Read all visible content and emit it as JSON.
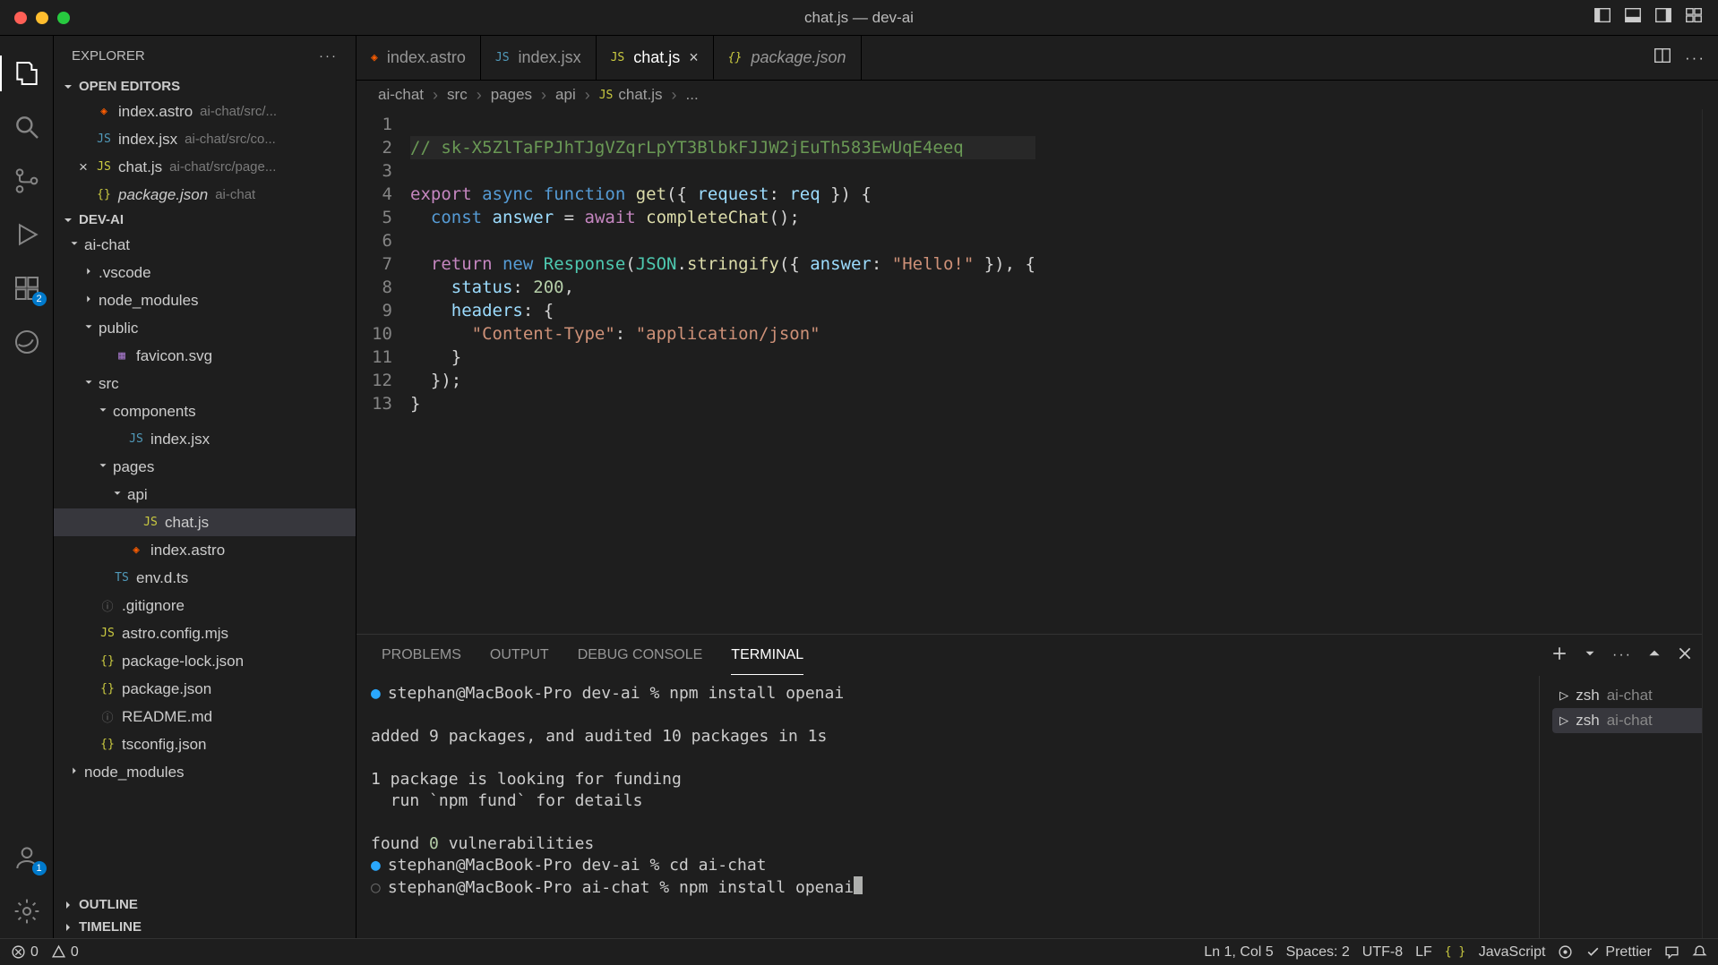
{
  "window": {
    "title": "chat.js — dev-ai"
  },
  "explorer": {
    "title": "EXPLORER",
    "openEditors": {
      "label": "OPEN EDITORS",
      "items": [
        {
          "name": "index.astro",
          "path": "ai-chat/src/...",
          "icon": "astro"
        },
        {
          "name": "index.jsx",
          "path": "ai-chat/src/co...",
          "icon": "jsx"
        },
        {
          "name": "chat.js",
          "path": "ai-chat/src/page...",
          "icon": "js",
          "closable": true
        },
        {
          "name": "package.json",
          "path": "ai-chat",
          "icon": "json",
          "italic": true
        }
      ]
    },
    "workspace": {
      "label": "DEV-AI",
      "tree": [
        {
          "name": "ai-chat",
          "type": "folder",
          "depth": 0,
          "expanded": true
        },
        {
          "name": ".vscode",
          "type": "folder",
          "depth": 1,
          "expanded": false
        },
        {
          "name": "node_modules",
          "type": "folder",
          "depth": 1,
          "expanded": false
        },
        {
          "name": "public",
          "type": "folder",
          "depth": 1,
          "expanded": true
        },
        {
          "name": "favicon.svg",
          "type": "file",
          "depth": 2,
          "icon": "svg"
        },
        {
          "name": "src",
          "type": "folder",
          "depth": 1,
          "expanded": true
        },
        {
          "name": "components",
          "type": "folder",
          "depth": 2,
          "expanded": true
        },
        {
          "name": "index.jsx",
          "type": "file",
          "depth": 3,
          "icon": "jsx"
        },
        {
          "name": "pages",
          "type": "folder",
          "depth": 2,
          "expanded": true
        },
        {
          "name": "api",
          "type": "folder",
          "depth": 3,
          "expanded": true
        },
        {
          "name": "chat.js",
          "type": "file",
          "depth": 4,
          "icon": "js",
          "active": true
        },
        {
          "name": "index.astro",
          "type": "file",
          "depth": 3,
          "icon": "astro"
        },
        {
          "name": "env.d.ts",
          "type": "file",
          "depth": 2,
          "icon": "ts"
        },
        {
          "name": ".gitignore",
          "type": "file",
          "depth": 1,
          "icon": "info"
        },
        {
          "name": "astro.config.mjs",
          "type": "file",
          "depth": 1,
          "icon": "js"
        },
        {
          "name": "package-lock.json",
          "type": "file",
          "depth": 1,
          "icon": "json"
        },
        {
          "name": "package.json",
          "type": "file",
          "depth": 1,
          "icon": "json"
        },
        {
          "name": "README.md",
          "type": "file",
          "depth": 1,
          "icon": "info"
        },
        {
          "name": "tsconfig.json",
          "type": "file",
          "depth": 1,
          "icon": "json"
        },
        {
          "name": "node_modules",
          "type": "folder",
          "depth": 0,
          "expanded": false
        }
      ]
    },
    "outline": "OUTLINE",
    "timeline": "TIMELINE"
  },
  "tabs": [
    {
      "name": "index.astro",
      "icon": "astro"
    },
    {
      "name": "index.jsx",
      "icon": "jsx"
    },
    {
      "name": "chat.js",
      "icon": "js",
      "active": true,
      "close": true
    },
    {
      "name": "package.json",
      "icon": "json",
      "italic": true
    }
  ],
  "breadcrumb": [
    "ai-chat",
    "src",
    "pages",
    "api",
    "chat.js",
    "..."
  ],
  "code": {
    "lines": 13,
    "l1_comment": "// 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",
    "l3": {
      "export": "export",
      "async": "async",
      "function": "function",
      "get": "get",
      "request": "request",
      "req": "req"
    },
    "l4": {
      "const": "const",
      "answer": "answer",
      "await": "await",
      "completeChat": "completeChat"
    },
    "l6": {
      "return": "return",
      "new": "new",
      "Response": "Response",
      "JSON": "JSON",
      "stringify": "stringify",
      "answer": "answer",
      "hello": "\"Hello!\""
    },
    "l7": {
      "status": "status",
      "v": "200"
    },
    "l8": {
      "headers": "headers"
    },
    "l9": {
      "key": "\"Content-Type\"",
      "val": "\"application/json\""
    }
  },
  "panel": {
    "tabs": {
      "problems": "PROBLEMS",
      "output": "OUTPUT",
      "debug": "DEBUG CONSOLE",
      "terminal": "TERMINAL"
    },
    "terminal": {
      "l1": {
        "prompt": "stephan@MacBook-Pro dev-ai %",
        "cmd": "npm install openai"
      },
      "l3": "added 9 packages, and audited 10 packages in 1s",
      "l5": "1 package is looking for funding",
      "l6": "  run `npm fund` for details",
      "l8a": "found ",
      "l8b": "0",
      "l8c": " vulnerabilities",
      "l9": {
        "prompt": "stephan@MacBook-Pro dev-ai %",
        "cmd": "cd ai-chat"
      },
      "l10": {
        "prompt": "stephan@MacBook-Pro ai-chat %",
        "cmd": "npm install openai"
      }
    },
    "sessions": [
      {
        "shell": "zsh",
        "dir": "ai-chat"
      },
      {
        "shell": "zsh",
        "dir": "ai-chat",
        "active": true
      }
    ]
  },
  "status": {
    "errors": "0",
    "warnings": "0",
    "cursor": "Ln 1, Col 5",
    "spaces": "Spaces: 2",
    "encoding": "UTF-8",
    "eol": "LF",
    "lang": "JavaScript",
    "prettier": "Prettier"
  },
  "activitybadges": {
    "ext": "2",
    "account": "1"
  }
}
